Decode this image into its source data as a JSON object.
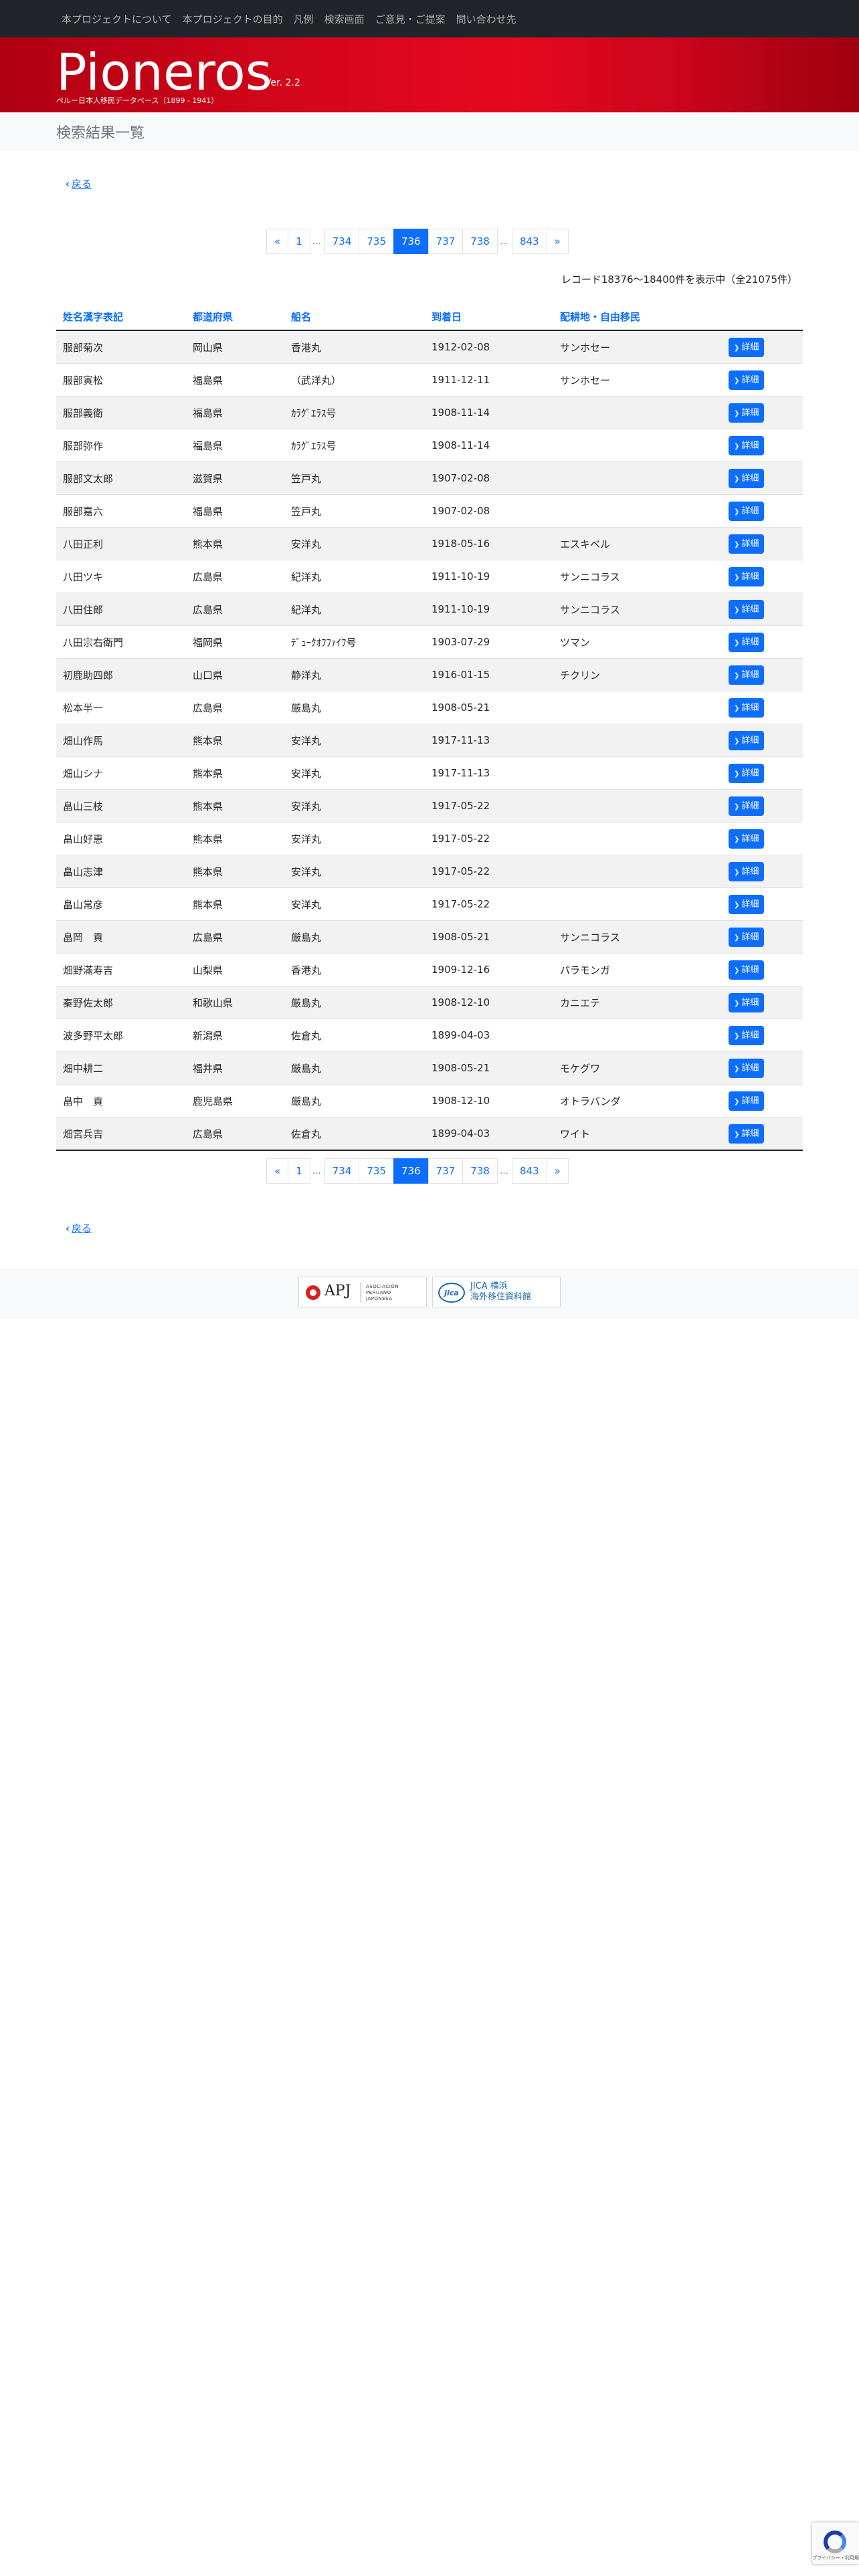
{
  "nav": {
    "links": [
      "本プロジェクトについて",
      "本プロジェクトの目的",
      "凡例",
      "検索画面",
      "ご意見・ご提案",
      "問い合わせ先"
    ]
  },
  "brand": {
    "title": "Pioneros",
    "version": "Ver. 2.2",
    "subtitle": "ペルー日本人移民データベース（1899 - 1941）"
  },
  "page": {
    "heading": "検索結果一覧",
    "back_label": "戻る",
    "record_count": "レコード18376〜18400件を表示中（全21075件）"
  },
  "pagination": {
    "prev": "«",
    "first": "1",
    "ellipsis": "…",
    "pages": [
      "734",
      "735",
      "736",
      "737",
      "738"
    ],
    "current": "736",
    "last": "843",
    "next": "»"
  },
  "table": {
    "headers": [
      "姓名漢字表記",
      "都道府県",
      "船名",
      "到着日",
      "配耕地・自由移民"
    ],
    "detail_label": "詳細",
    "rows": [
      {
        "name": "服部菊次",
        "pref": "岡山県",
        "ship": "香港丸",
        "date": "1912-02-08",
        "place": "サンホセー"
      },
      {
        "name": "服部寅松",
        "pref": "福島県",
        "ship": "（武洋丸）",
        "date": "1911-12-11",
        "place": "サンホセー"
      },
      {
        "name": "服部義衛",
        "pref": "福島県",
        "ship": "ｶﾗｸﾞｴﾗｽ号",
        "date": "1908-11-14",
        "place": ""
      },
      {
        "name": "服部弥作",
        "pref": "福島県",
        "ship": "ｶﾗｸﾞｴﾗｽ号",
        "date": "1908-11-14",
        "place": ""
      },
      {
        "name": "服部文太郎",
        "pref": "滋賀県",
        "ship": "笠戸丸",
        "date": "1907-02-08",
        "place": ""
      },
      {
        "name": "服部嘉六",
        "pref": "福島県",
        "ship": "笠戸丸",
        "date": "1907-02-08",
        "place": ""
      },
      {
        "name": "八田正利",
        "pref": "熊本県",
        "ship": "安洋丸",
        "date": "1918-05-16",
        "place": "エスキベル"
      },
      {
        "name": "八田ツキ",
        "pref": "広島県",
        "ship": "紀洋丸",
        "date": "1911-10-19",
        "place": "サンニコラス"
      },
      {
        "name": "八田住郎",
        "pref": "広島県",
        "ship": "紀洋丸",
        "date": "1911-10-19",
        "place": "サンニコラス"
      },
      {
        "name": "八田宗右衛門",
        "pref": "福岡県",
        "ship": "ﾃﾞｭｰｸｵﾌﾌｧｲﾌ号",
        "date": "1903-07-29",
        "place": "ツマン"
      },
      {
        "name": "初鹿助四郎",
        "pref": "山口県",
        "ship": "静洋丸",
        "date": "1916-01-15",
        "place": "チクリン"
      },
      {
        "name": "松本半一",
        "pref": "広島県",
        "ship": "厳島丸",
        "date": "1908-05-21",
        "place": ""
      },
      {
        "name": "畑山作馬",
        "pref": "熊本県",
        "ship": "安洋丸",
        "date": "1917-11-13",
        "place": ""
      },
      {
        "name": "畑山シナ",
        "pref": "熊本県",
        "ship": "安洋丸",
        "date": "1917-11-13",
        "place": ""
      },
      {
        "name": "畠山三枝",
        "pref": "熊本県",
        "ship": "安洋丸",
        "date": "1917-05-22",
        "place": ""
      },
      {
        "name": "畠山好恵",
        "pref": "熊本県",
        "ship": "安洋丸",
        "date": "1917-05-22",
        "place": ""
      },
      {
        "name": "畠山志津",
        "pref": "熊本県",
        "ship": "安洋丸",
        "date": "1917-05-22",
        "place": ""
      },
      {
        "name": "畠山常彦",
        "pref": "熊本県",
        "ship": "安洋丸",
        "date": "1917-05-22",
        "place": ""
      },
      {
        "name": "畠岡　貢",
        "pref": "広島県",
        "ship": "厳島丸",
        "date": "1908-05-21",
        "place": "サンニコラス"
      },
      {
        "name": "畑野滿寿吉",
        "pref": "山梨県",
        "ship": "香港丸",
        "date": "1909-12-16",
        "place": "パラモンガ"
      },
      {
        "name": "秦野佐太郎",
        "pref": "和歌山県",
        "ship": "厳島丸",
        "date": "1908-12-10",
        "place": "カニエテ"
      },
      {
        "name": "波多野平太郎",
        "pref": "新潟県",
        "ship": "佐倉丸",
        "date": "1899-04-03",
        "place": ""
      },
      {
        "name": "畑中耕二",
        "pref": "福井県",
        "ship": "厳島丸",
        "date": "1908-05-21",
        "place": "モケグワ"
      },
      {
        "name": "畠中　貢",
        "pref": "鹿児島県",
        "ship": "厳島丸",
        "date": "1908-12-10",
        "place": "オトラバンダ"
      },
      {
        "name": "畑宮兵吉",
        "pref": "広島県",
        "ship": "佐倉丸",
        "date": "1899-04-03",
        "place": "ワイト"
      }
    ]
  },
  "footer": {
    "apj_text": "APJ",
    "apj_sub": [
      "ASOCIACIÓN",
      "PERUANO",
      "JAPONESA"
    ],
    "jica_mark": "jica",
    "jica_lines": [
      "JICA 横浜",
      "海外移住資料館"
    ]
  },
  "colors": {
    "navbar": "#212529",
    "banner": "#d5061b",
    "accent": "#0d6efd"
  },
  "icons": {
    "back": "chevron-left-icon",
    "detail": "chevron-right-icon"
  },
  "recaptcha": {
    "label": "プライバシー・利用規約"
  }
}
